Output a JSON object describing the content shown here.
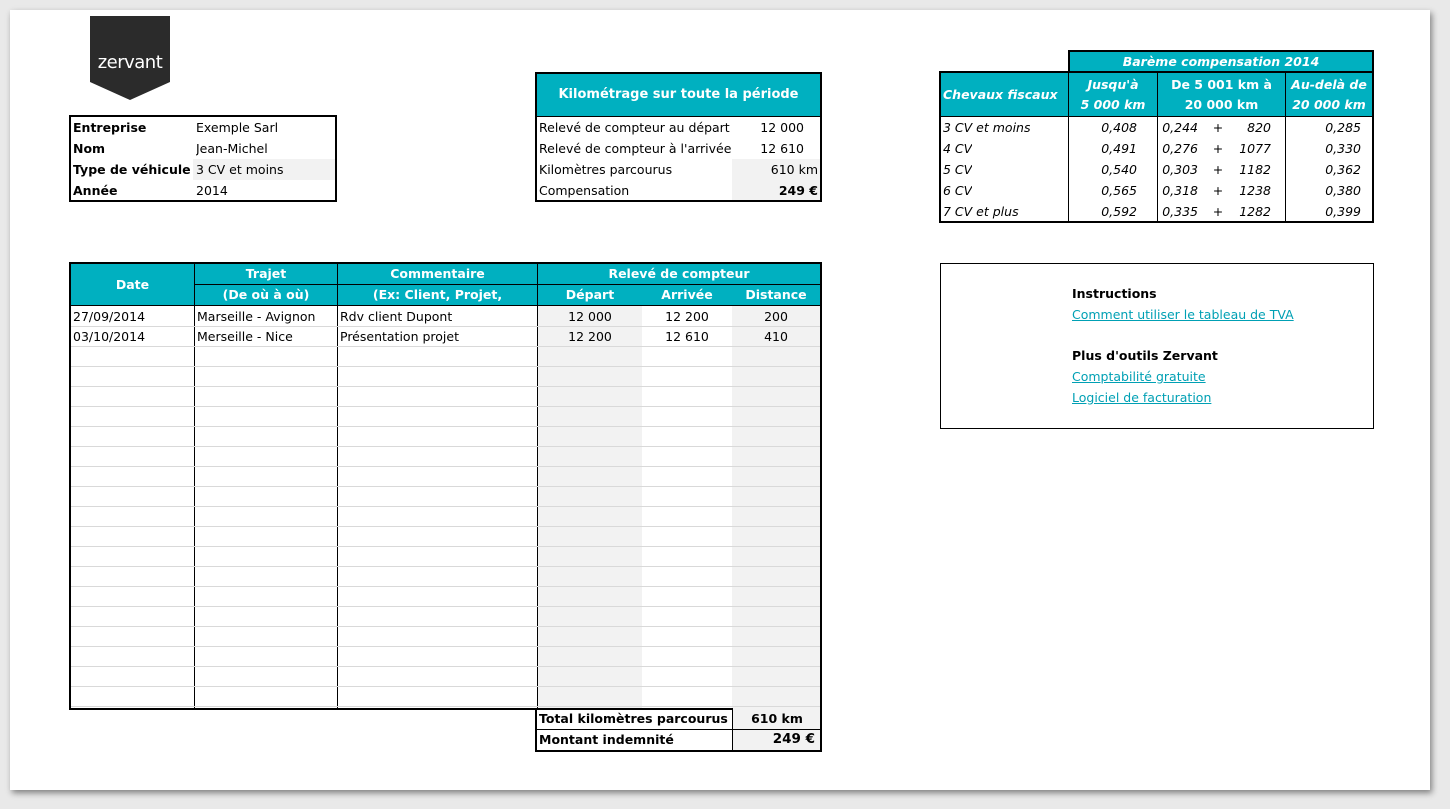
{
  "brand": {
    "logo_text": "zervant"
  },
  "info": {
    "rows": [
      {
        "label": "Entreprise",
        "value": "Exemple Sarl"
      },
      {
        "label": "Nom",
        "value": "Jean-Michel"
      },
      {
        "label": "Type de véhicule",
        "value": "3 CV et moins"
      },
      {
        "label": "Année",
        "value": "2014"
      }
    ]
  },
  "kilometrage": {
    "title": "Kilométrage sur toute la période",
    "rows": [
      {
        "label": "Relevé de compteur au départ",
        "value": "12 000"
      },
      {
        "label": "Relevé de compteur à l'arrivée",
        "value": "12 610"
      },
      {
        "label": "Kilomètres parcourus",
        "value": "610 km"
      },
      {
        "label": "Compensation",
        "value": "249 €"
      }
    ]
  },
  "bareme": {
    "title": "Barème compensation 2014",
    "col_cv": "Chevaux fiscaux",
    "col1": [
      "Jusqu'à",
      "5 000 km"
    ],
    "col2": [
      "De 5 001 km à",
      "20 000 km"
    ],
    "col3": [
      "Au-delà de",
      "20 000 km"
    ],
    "rows": [
      {
        "cv": "3 CV et moins",
        "a": "0,408",
        "b": "0,244",
        "plus": "+",
        "c": "820",
        "d": "0,285"
      },
      {
        "cv": "4 CV",
        "a": "0,491",
        "b": "0,276",
        "plus": "+",
        "c": "1077",
        "d": "0,330"
      },
      {
        "cv": "5 CV",
        "a": "0,540",
        "b": "0,303",
        "plus": "+",
        "c": "1182",
        "d": "0,362"
      },
      {
        "cv": "6 CV",
        "a": "0,565",
        "b": "0,318",
        "plus": "+",
        "c": "1238",
        "d": "0,380"
      },
      {
        "cv": "7 CV et plus",
        "a": "0,592",
        "b": "0,335",
        "plus": "+",
        "c": "1282",
        "d": "0,399"
      }
    ]
  },
  "log": {
    "headers": {
      "date": "Date",
      "trajet": "Trajet",
      "trajet_sub": "(De où à où)",
      "commentaire": "Commentaire",
      "commentaire_sub": "(Ex: Client, Projet, Réunion...)",
      "releve": "Relevé de compteur",
      "depart": "Départ",
      "arrivee": "Arrivée",
      "distance": "Distance"
    },
    "rows": [
      {
        "date": "27/09/2014",
        "trajet": "Marseille - Avignon",
        "commentaire": "Rdv client Dupont",
        "depart": "12 000",
        "arrivee": "12 200",
        "distance": "200"
      },
      {
        "date": "03/10/2014",
        "trajet": "Merseille - Nice",
        "commentaire": "Présentation projet",
        "depart": "12 200",
        "arrivee": "12 610",
        "distance": "410"
      }
    ],
    "totals": {
      "km_label": "Total kilomètres parcourus",
      "km_value": "610 km",
      "amount_label": "Montant indemnité",
      "amount_value": "249 €"
    }
  },
  "instructions": {
    "title": "Instructions",
    "link1": "Comment utiliser le tableau de TVA ",
    "title2": "Plus d'outils Zervant",
    "link2": "Comptabilité gratuite",
    "link3": "Logiciel de facturation"
  }
}
